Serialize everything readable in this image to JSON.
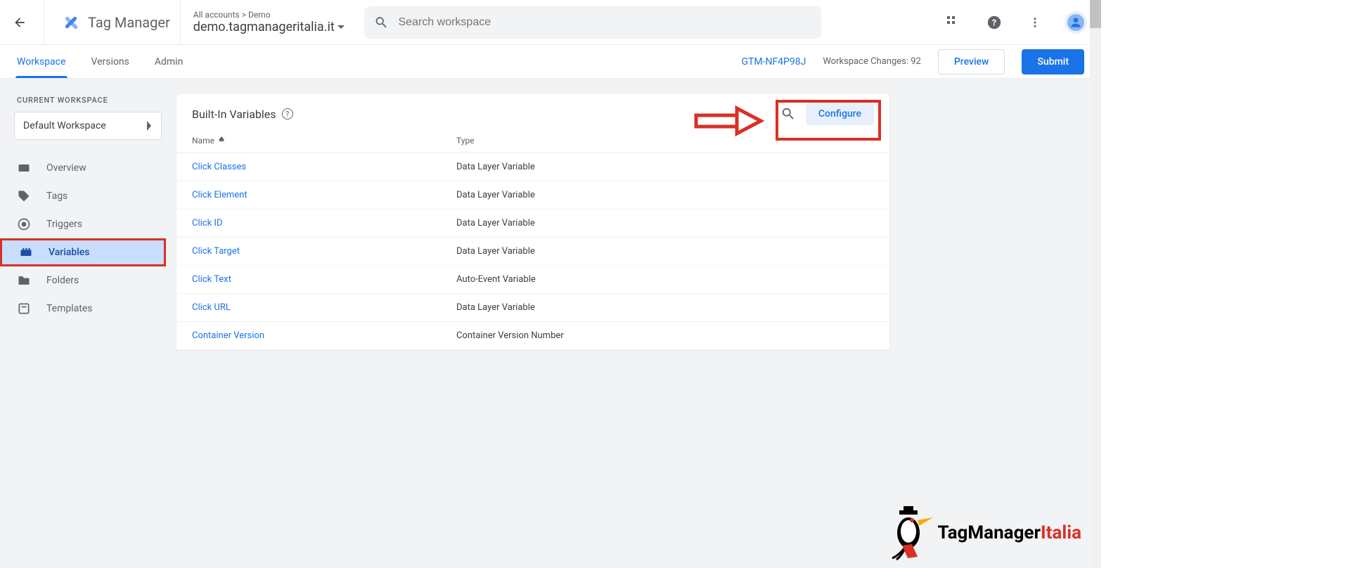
{
  "header": {
    "product": "Tag Manager",
    "breadcrumb": "All accounts > Demo",
    "container": "demo.tagmanageritalia.it",
    "search_placeholder": "Search workspace"
  },
  "nav": {
    "tabs": [
      "Workspace",
      "Versions",
      "Admin"
    ],
    "active_tab": 0,
    "container_id": "GTM-NF4P98J",
    "changes_label": "Workspace Changes: 92",
    "preview": "Preview",
    "submit": "Submit"
  },
  "sidebar": {
    "section_label": "CURRENT WORKSPACE",
    "workspace": "Default Workspace",
    "items": [
      {
        "label": "Overview"
      },
      {
        "label": "Tags"
      },
      {
        "label": "Triggers"
      },
      {
        "label": "Variables",
        "active": true
      },
      {
        "label": "Folders"
      },
      {
        "label": "Templates"
      }
    ]
  },
  "card": {
    "title": "Built-In Variables",
    "configure": "Configure",
    "columns": {
      "name": "Name",
      "type": "Type"
    },
    "rows": [
      {
        "name": "Click Classes",
        "type": "Data Layer Variable"
      },
      {
        "name": "Click Element",
        "type": "Data Layer Variable"
      },
      {
        "name": "Click ID",
        "type": "Data Layer Variable"
      },
      {
        "name": "Click Target",
        "type": "Data Layer Variable"
      },
      {
        "name": "Click Text",
        "type": "Auto-Event Variable"
      },
      {
        "name": "Click URL",
        "type": "Data Layer Variable"
      },
      {
        "name": "Container Version",
        "type": "Container Version Number"
      }
    ]
  },
  "watermark": {
    "part1": "TagManager",
    "part2": "Italia"
  }
}
